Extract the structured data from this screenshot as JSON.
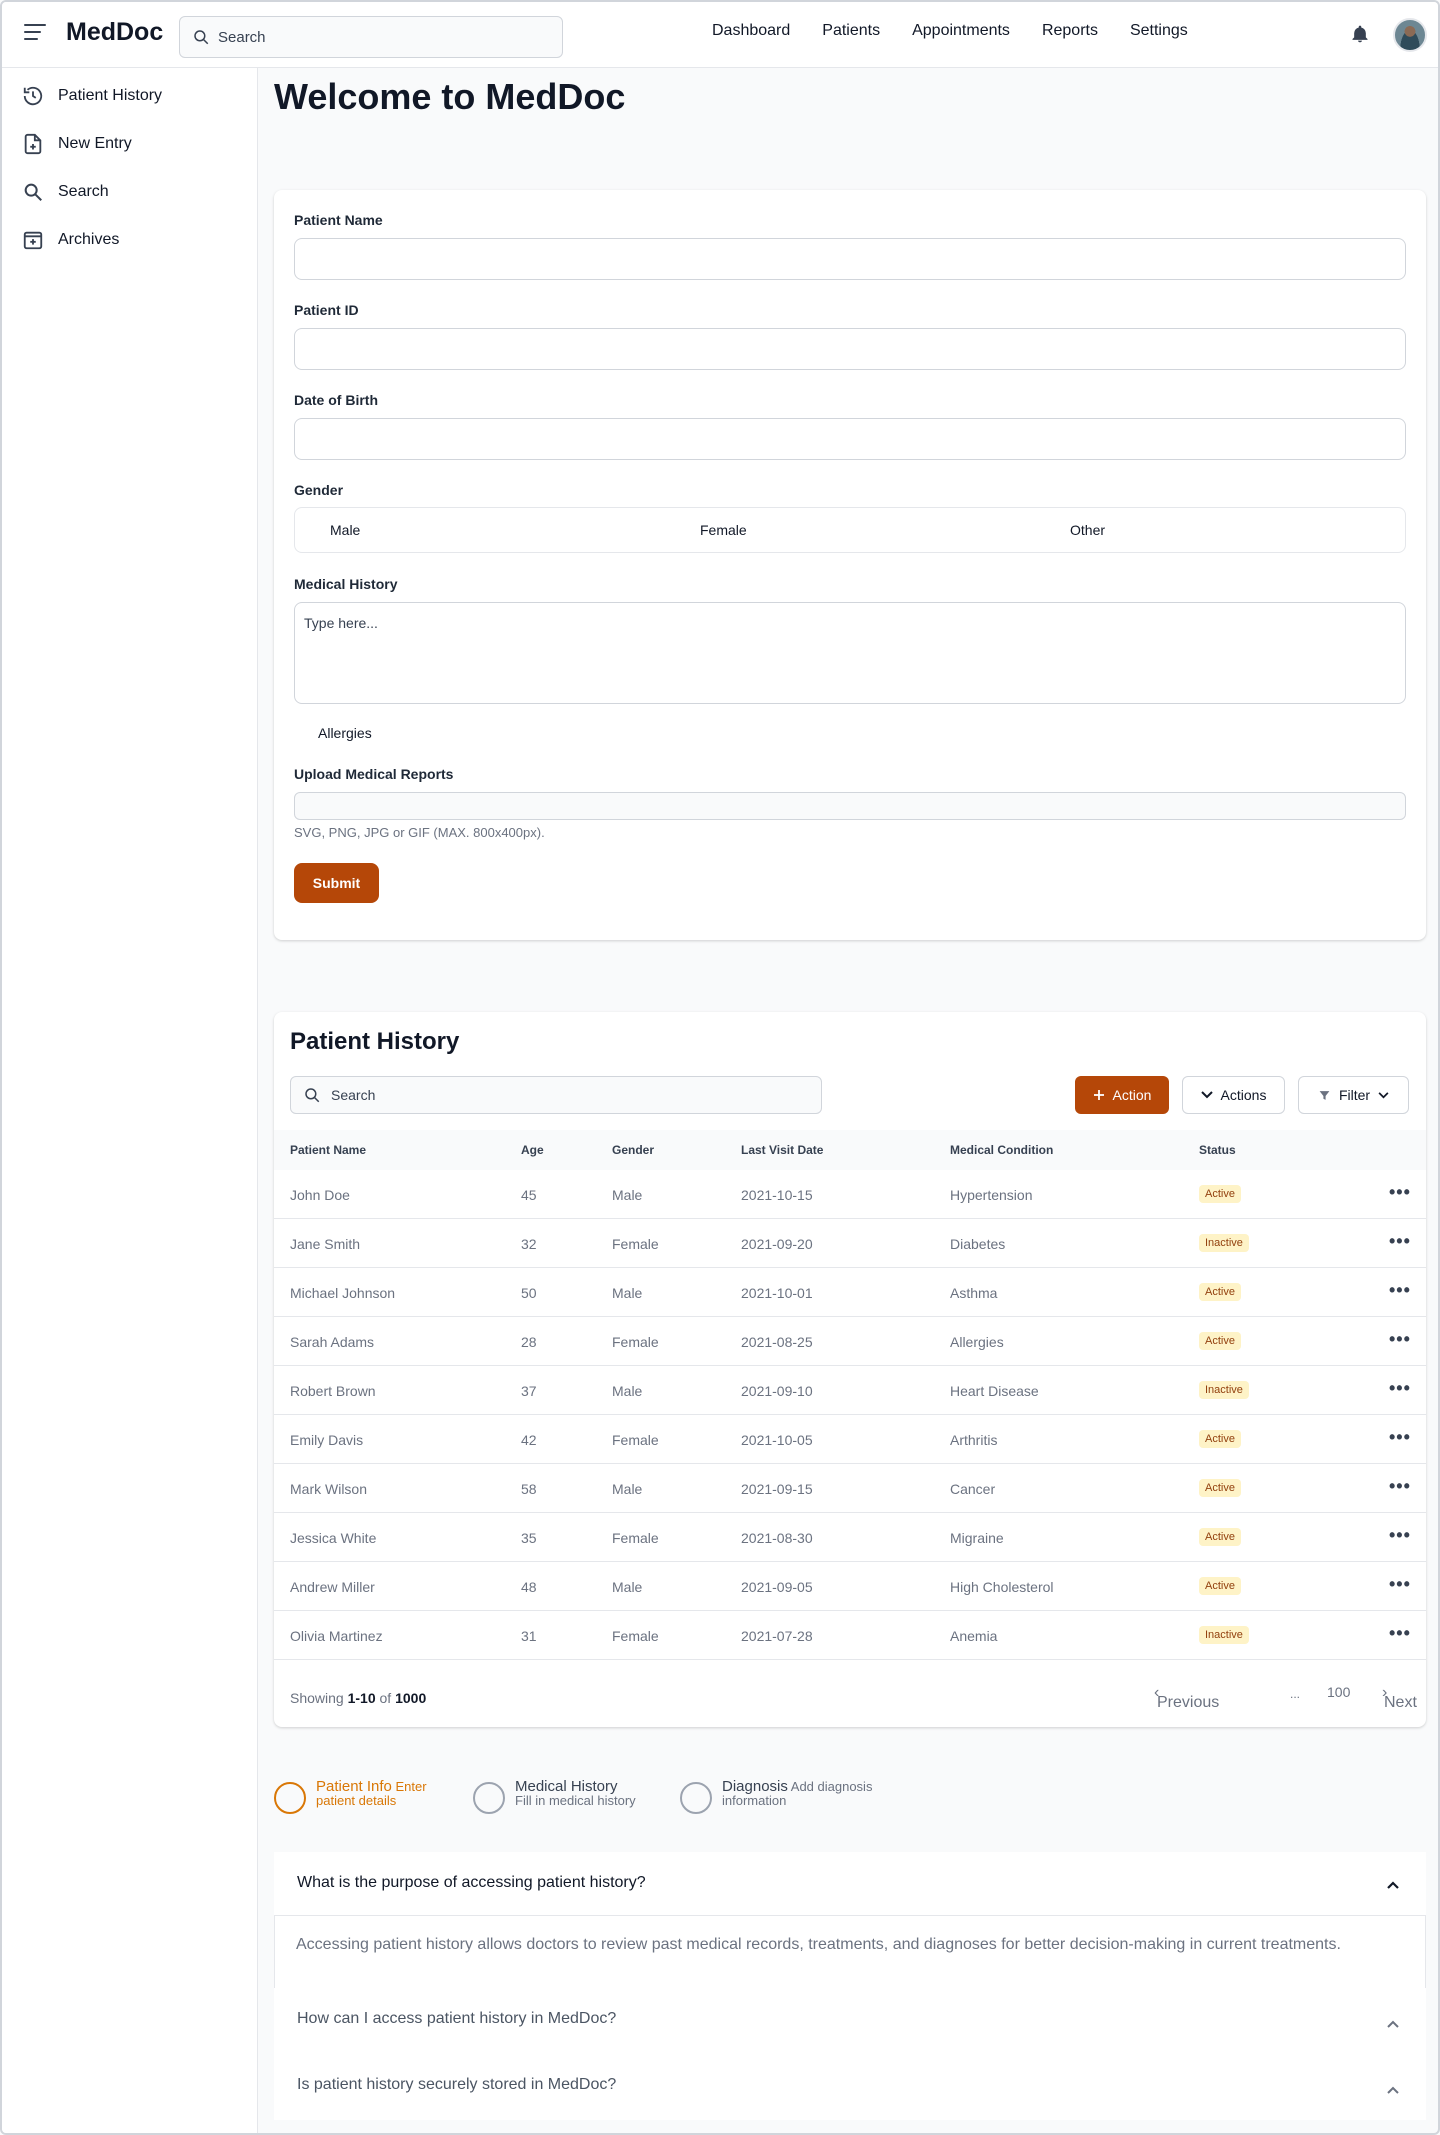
{
  "app": {
    "brand": "MedDoc",
    "search_placeholder": "Search"
  },
  "nav": [
    "Dashboard",
    "Patients",
    "Appointments",
    "Reports",
    "Settings"
  ],
  "sidebar": [
    {
      "label": "Patient History",
      "icon": "history-icon"
    },
    {
      "label": "New Entry",
      "icon": "file-plus-icon"
    },
    {
      "label": "Search",
      "icon": "search-icon"
    },
    {
      "label": "Archives",
      "icon": "archive-icon"
    }
  ],
  "page_title": "Welcome to MedDoc",
  "form": {
    "patient_name_label": "Patient Name",
    "patient_id_label": "Patient ID",
    "dob_label": "Date of Birth",
    "gender_label": "Gender",
    "gender_options": [
      "Male",
      "Female",
      "Other"
    ],
    "medical_history_label": "Medical History",
    "medical_history_placeholder": "Type here...",
    "allergies_label": "Allergies",
    "upload_label": "Upload Medical Reports",
    "upload_hint": "SVG, PNG, JPG or GIF (MAX. 800x400px).",
    "submit_label": "Submit"
  },
  "history": {
    "title": "Patient History",
    "search_placeholder": "Search",
    "action_label": "Action",
    "actions_label": "Actions",
    "filter_label": "Filter",
    "columns": [
      "Patient Name",
      "Age",
      "Gender",
      "Last Visit Date",
      "Medical Condition",
      "Status"
    ],
    "rows": [
      [
        "John Doe",
        "45",
        "Male",
        "2021-10-15",
        "Hypertension",
        "Active"
      ],
      [
        "Jane Smith",
        "32",
        "Female",
        "2021-09-20",
        "Diabetes",
        "Inactive"
      ],
      [
        "Michael Johnson",
        "50",
        "Male",
        "2021-10-01",
        "Asthma",
        "Active"
      ],
      [
        "Sarah Adams",
        "28",
        "Female",
        "2021-08-25",
        "Allergies",
        "Active"
      ],
      [
        "Robert Brown",
        "37",
        "Male",
        "2021-09-10",
        "Heart Disease",
        "Inactive"
      ],
      [
        "Emily Davis",
        "42",
        "Female",
        "2021-10-05",
        "Arthritis",
        "Active"
      ],
      [
        "Mark Wilson",
        "58",
        "Male",
        "2021-09-15",
        "Cancer",
        "Active"
      ],
      [
        "Jessica White",
        "35",
        "Female",
        "2021-08-30",
        "Migraine",
        "Active"
      ],
      [
        "Andrew Miller",
        "48",
        "Male",
        "2021-09-05",
        "High Cholesterol",
        "Active"
      ],
      [
        "Olivia Martinez",
        "31",
        "Female",
        "2021-07-28",
        "Anemia",
        "Inactive"
      ]
    ],
    "showing_prefix": "Showing",
    "showing_range": "1-10",
    "showing_of": "of",
    "showing_total": "1000",
    "pagination": {
      "prev": "Previous",
      "ellipsis": "...",
      "last": "100",
      "next": "Next"
    }
  },
  "stepper": [
    {
      "title": "Patient Info",
      "desc": "Enter patient details",
      "active": true
    },
    {
      "title": "Medical History",
      "desc": "Fill in medical history",
      "active": false
    },
    {
      "title": "Diagnosis",
      "desc": "Add diagnosis information",
      "active": false
    }
  ],
  "faq": [
    {
      "q": "What is the purpose of accessing patient history?",
      "a": "Accessing patient history allows doctors to review past medical records, treatments, and diagnoses for better decision-making in current treatments.",
      "open": true
    },
    {
      "q": "How can I access patient history in MedDoc?",
      "open": false
    },
    {
      "q": "Is patient history securely stored in MedDoc?",
      "open": false
    }
  ],
  "colors": {
    "accent": "#b54708",
    "badge_bg": "#fef3c7",
    "badge_text": "#92400e",
    "step_active": "#d97706"
  }
}
